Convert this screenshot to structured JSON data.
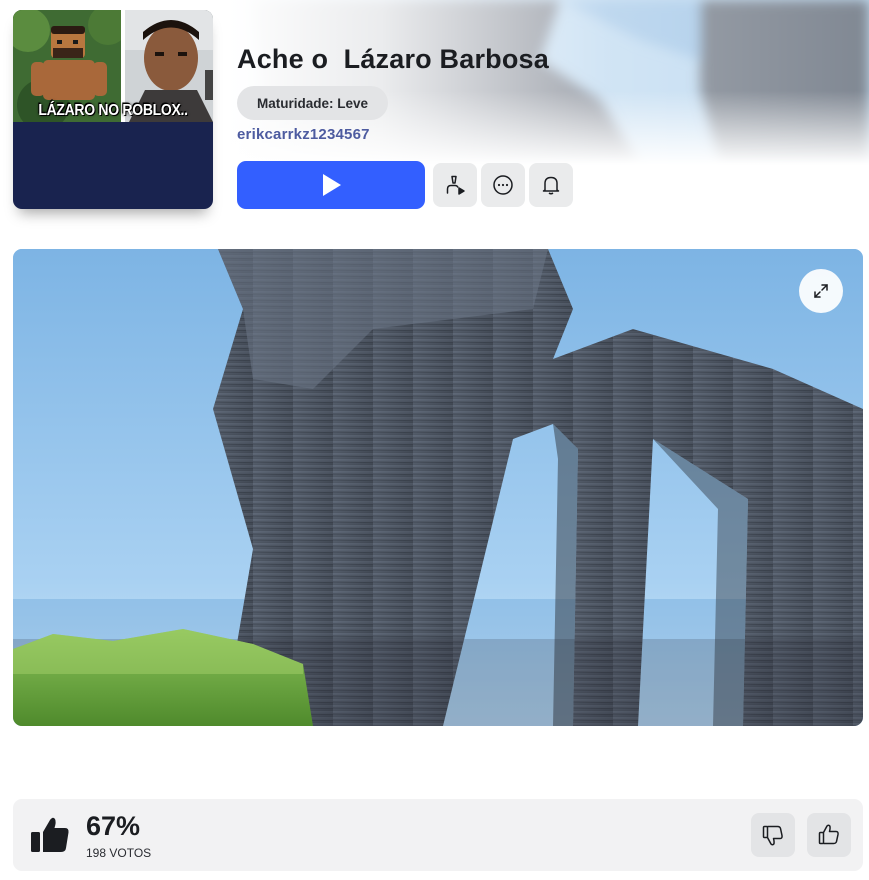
{
  "game": {
    "title": "Ache o  Lázaro Barbosa",
    "maturity_label": "Maturidade: Leve",
    "creator": "erikcarrkz1234567",
    "thumbnail_caption": "LÁZARO NO ROBLOX..",
    "thumbnail_bg_color": "#19234f"
  },
  "actions": {
    "play_icon": "play-icon",
    "play_color": "#335fff",
    "buttons": [
      "invite-friend-icon",
      "more-options-icon",
      "notification-bell-icon"
    ]
  },
  "media": {
    "expand_icon": "expand-icon"
  },
  "rating": {
    "percent": "67%",
    "votes_count": "198",
    "votes_label": "VOTOS",
    "upvote_icon": "thumbs-up-icon",
    "downvote_icon": "thumbs-down-icon"
  }
}
